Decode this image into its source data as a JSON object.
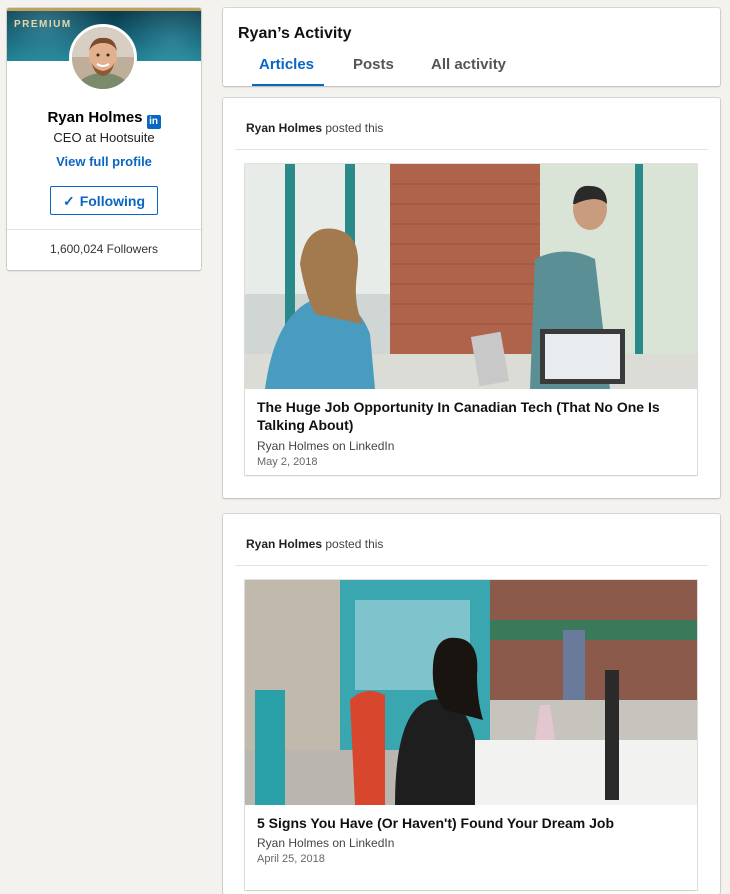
{
  "profile": {
    "badge": "PREMIUM",
    "name": "Ryan Holmes",
    "linkedin_badge": "in",
    "headline": "CEO at Hootsuite",
    "view_profile_link": "View full profile",
    "follow_check": "✓",
    "follow_label": "Following",
    "followers": "1,600,024 Followers"
  },
  "activity": {
    "title": "Ryan’s Activity",
    "tabs": [
      {
        "label": "Articles",
        "active": true
      },
      {
        "label": "Posts",
        "active": false
      },
      {
        "label": "All activity",
        "active": false
      }
    ]
  },
  "posts": [
    {
      "author": "Ryan Holmes",
      "action": "posted this",
      "article": {
        "title": "The Huge Job Opportunity In Canadian Tech (That No One Is Talking About)",
        "source": "Ryan Holmes on LinkedIn",
        "date": "May 2, 2018"
      }
    },
    {
      "author": "Ryan Holmes",
      "action": "posted this",
      "article": {
        "title": "5 Signs You Have (Or Haven't) Found Your Dream Job",
        "source": "Ryan Holmes on LinkedIn",
        "date": "April 25, 2018"
      }
    }
  ],
  "colors": {
    "accent": "#0a66c2",
    "page_background": "#f3f2ef",
    "premium_gold": "#c4a15a"
  }
}
